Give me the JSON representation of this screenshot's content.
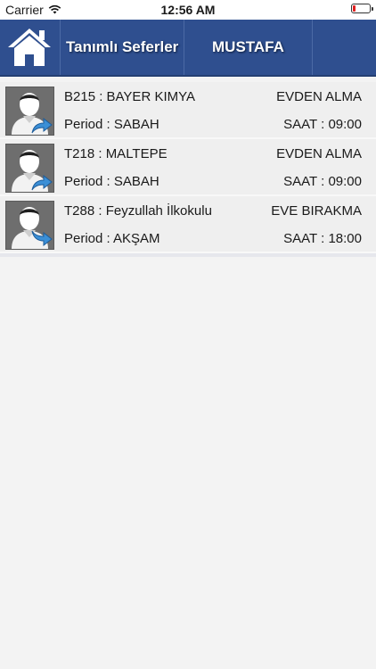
{
  "status_bar": {
    "carrier": "Carrier",
    "time": "12:56 AM"
  },
  "navbar": {
    "title": "Tanımlı Seferler",
    "user": "MUSTAFA",
    "color": "#2f4f8f"
  },
  "trips": [
    {
      "route": "B215 : BAYER KIMYA",
      "type": "EVDEN ALMA",
      "period": "Period : SABAH",
      "time": "SAAT : 09:00",
      "direction": "up"
    },
    {
      "route": "T218 : MALTEPE",
      "type": "EVDEN ALMA",
      "period": "Period : SABAH",
      "time": "SAAT : 09:00",
      "direction": "up"
    },
    {
      "route": "T288 : Feyzullah İlkokulu",
      "type": "EVE BIRAKMA",
      "period": "Period : AKŞAM",
      "time": "SAAT : 18:00",
      "direction": "down"
    }
  ]
}
